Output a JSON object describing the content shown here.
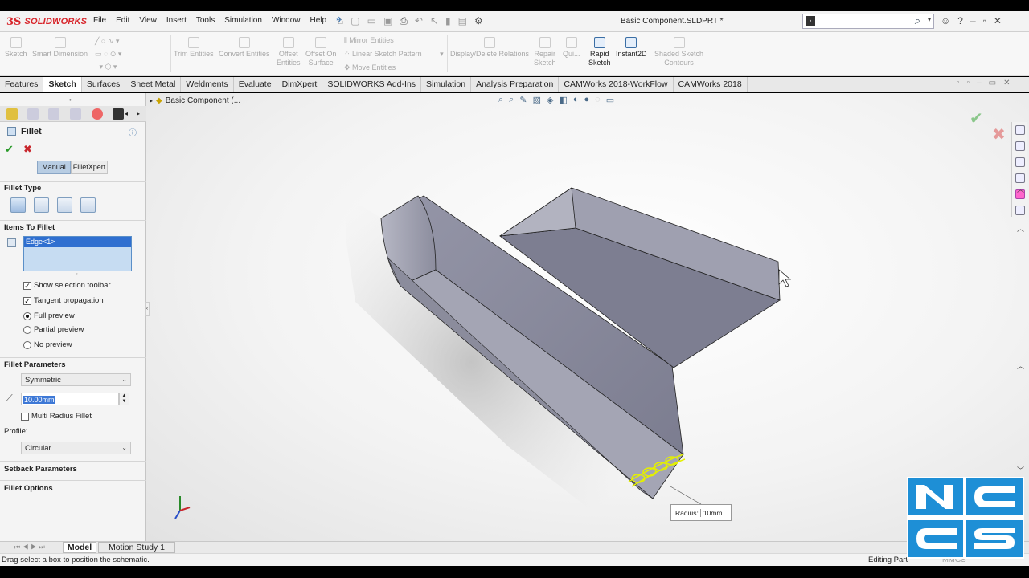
{
  "app": {
    "brand": "SOLIDWORKS",
    "brand_mark": "3S",
    "doc_title": "Basic Component.SLDPRT *"
  },
  "menu": [
    "File",
    "Edit",
    "View",
    "Insert",
    "Tools",
    "Simulation",
    "Window",
    "Help"
  ],
  "search": {
    "placeholder": ""
  },
  "ribbon": {
    "sketch": "Sketch",
    "smart_dimension": "Smart Dimension",
    "trim_entities": "Trim Entities",
    "convert_entities": "Convert Entities",
    "offset_entities_1": "Offset",
    "offset_entities_2": "Entities",
    "offset_on_surface_1": "Offset On",
    "offset_on_surface_2": "Surface",
    "mirror_entities": "Mirror Entities",
    "linear_sketch_pattern": "Linear Sketch Pattern",
    "move_entities": "Move Entities",
    "display_delete_relations": "Display/Delete Relations",
    "repair_sketch_1": "Repair",
    "repair_sketch_2": "Sketch",
    "quick_snaps": "Qui...",
    "rapid_sketch_1": "Rapid",
    "rapid_sketch_2": "Sketch",
    "instant2d": "Instant2D",
    "shaded_sketch_1": "Shaded Sketch",
    "shaded_sketch_2": "Contours"
  },
  "tabs": [
    "Features",
    "Sketch",
    "Surfaces",
    "Sheet Metal",
    "Weldments",
    "Evaluate",
    "DimXpert",
    "SOLIDWORKS Add-Ins",
    "Simulation",
    "Analysis Preparation",
    "CAMWorks 2018-WorkFlow",
    "CAMWorks 2018"
  ],
  "active_tab": "Sketch",
  "breadcrumb": "Basic Component  (...",
  "property_manager": {
    "title": "Fillet",
    "mode_manual": "Manual",
    "mode_filletxpert": "FilletXpert",
    "fillet_type": "Fillet Type",
    "items_to_fillet": "Items To Fillet",
    "selected_item": "Edge<1>",
    "show_selection_toolbar": "Show selection toolbar",
    "tangent_propagation": "Tangent propagation",
    "full_preview": "Full preview",
    "partial_preview": "Partial preview",
    "no_preview": "No preview",
    "fillet_parameters": "Fillet Parameters",
    "symmetric": "Symmetric",
    "radius_value": "10.00mm",
    "multi_radius_fillet": "Multi Radius Fillet",
    "profile_label": "Profile:",
    "profile_value": "Circular",
    "setback_parameters": "Setback Parameters",
    "fillet_options": "Fillet Options"
  },
  "callout": {
    "label": "Radius:",
    "value": "10mm"
  },
  "bottom_tabs": {
    "model": "Model",
    "motion_study": "Motion Study 1"
  },
  "status": {
    "message": "Drag select a box to position the schematic.",
    "mode": "Editing Part",
    "units": "MMGS"
  },
  "colors": {
    "accent": "#3a6ea5",
    "brand": "#d8262c",
    "part_face": "#8a8a9a",
    "preview_edge": "#e4f000",
    "logo_blue": "#1e8fd6"
  }
}
